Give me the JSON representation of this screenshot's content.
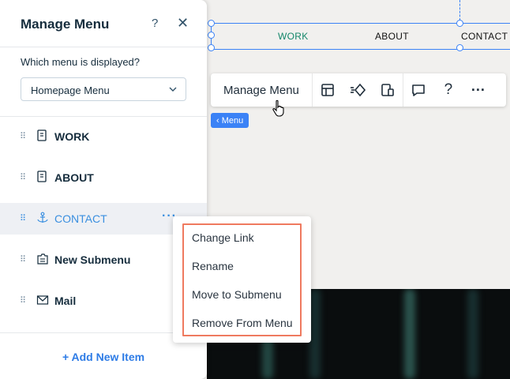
{
  "panel": {
    "title": "Manage Menu",
    "help": "?",
    "close": "✕",
    "question": "Which menu is displayed?",
    "dropdown_value": "Homepage Menu",
    "items": [
      {
        "label": "WORK",
        "icon": "page-icon"
      },
      {
        "label": "ABOUT",
        "icon": "page-icon"
      },
      {
        "label": "CONTACT",
        "icon": "anchor-icon",
        "selected": true
      },
      {
        "label": "New Submenu",
        "icon": "submenu-icon"
      },
      {
        "label": "Mail",
        "icon": "mail-icon"
      }
    ],
    "add_item": "+ Add New Item"
  },
  "canvas_nav": {
    "items": [
      "WORK",
      "ABOUT",
      "CONTACT"
    ],
    "active_color": "#14876a"
  },
  "toolbar": {
    "manage_label": "Manage Menu",
    "icons": [
      "layout-icon",
      "animation-icon",
      "devices-icon",
      "comment-icon",
      "help-icon",
      "more-icon"
    ],
    "help": "?",
    "more": "···"
  },
  "breadcrumb_chip": "‹ Menu",
  "context_menu": {
    "items": [
      "Change Link",
      "Rename",
      "Move to Submenu",
      "Remove From Menu"
    ],
    "highlight_color": "#ef7a5f"
  },
  "colors": {
    "accent": "#3b82f6",
    "link": "#2e7ce6"
  }
}
